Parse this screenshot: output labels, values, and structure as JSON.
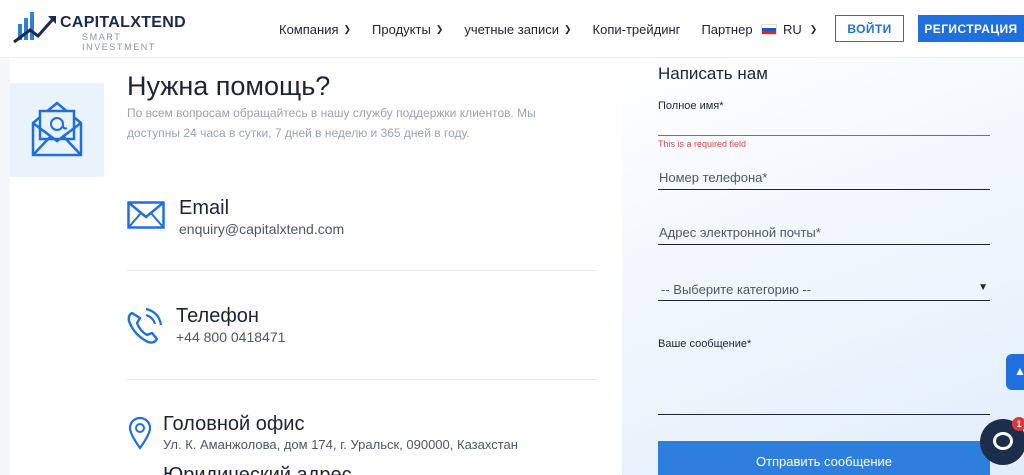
{
  "brand": {
    "name": "CAPITALXTEND",
    "tagline": "SMART INVESTMENT"
  },
  "nav": {
    "items": [
      {
        "label": "Компания",
        "has_dropdown": true
      },
      {
        "label": "Продукты",
        "has_dropdown": true
      },
      {
        "label": "учетные записи",
        "has_dropdown": true
      },
      {
        "label": "Копи-трейдинг",
        "has_dropdown": false
      },
      {
        "label": "Партнер",
        "has_dropdown": false
      }
    ],
    "language": "RU",
    "login_label": "ВОЙТИ",
    "register_label": "РЕГИСТРАЦИЯ"
  },
  "help": {
    "title": "Нужна помощь?",
    "text": "По всем вопросам обращайтесь в нашу службу поддержки клиентов. Мы доступны 24 часа в сутки, 7 дней в неделю и 365 дней в году."
  },
  "contacts": {
    "email": {
      "title": "Email",
      "value": "enquiry@capitalxtend.com",
      "icon": "envelope-icon"
    },
    "phone": {
      "title": "Телефон",
      "value": "+44 800 0418471",
      "icon": "phone-icon"
    },
    "office": {
      "title": "Головной офис",
      "value": "Ул. К. Аманжолова, дом 174, г. Уральск, 090000, Казахстан",
      "icon": "location-pin-icon"
    },
    "legal": {
      "title": "Юридический адрес"
    }
  },
  "form": {
    "title": "Написать нам",
    "full_name_label": "Полное имя*",
    "full_name_error": "This is a required field",
    "phone_placeholder": "Номер телефона*",
    "email_placeholder": "Адрес электронной почты*",
    "category_placeholder": "-- Выберите категорию --",
    "message_label": "Ваше сообщение*",
    "submit_label": "Отправить сообщение"
  },
  "chat": {
    "badge_count": "1"
  },
  "colors": {
    "accent": "#1f6fde",
    "error": "#d8484e",
    "text": "#1c2433"
  }
}
